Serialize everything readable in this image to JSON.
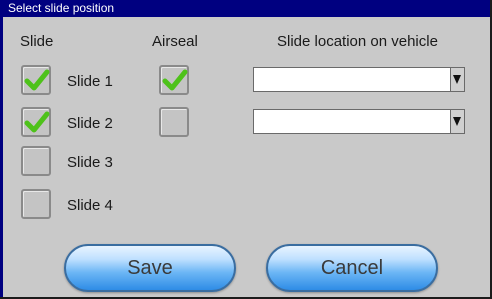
{
  "window": {
    "title": "Select slide position"
  },
  "headers": {
    "slide": "Slide",
    "airseal": "Airseal",
    "location": "Slide location on vehicle"
  },
  "slides": [
    {
      "label": "Slide 1",
      "slide_checked": true,
      "airseal_checked": true,
      "location": ""
    },
    {
      "label": "Slide 2",
      "slide_checked": true,
      "airseal_checked": false,
      "location": ""
    },
    {
      "label": "Slide 3",
      "slide_checked": false
    },
    {
      "label": "Slide 4",
      "slide_checked": false
    }
  ],
  "buttons": {
    "save": "Save",
    "cancel": "Cancel"
  },
  "colors": {
    "titlebar": "#000080",
    "check": "#4ec21a",
    "button_accent": "#2e8ce6"
  }
}
